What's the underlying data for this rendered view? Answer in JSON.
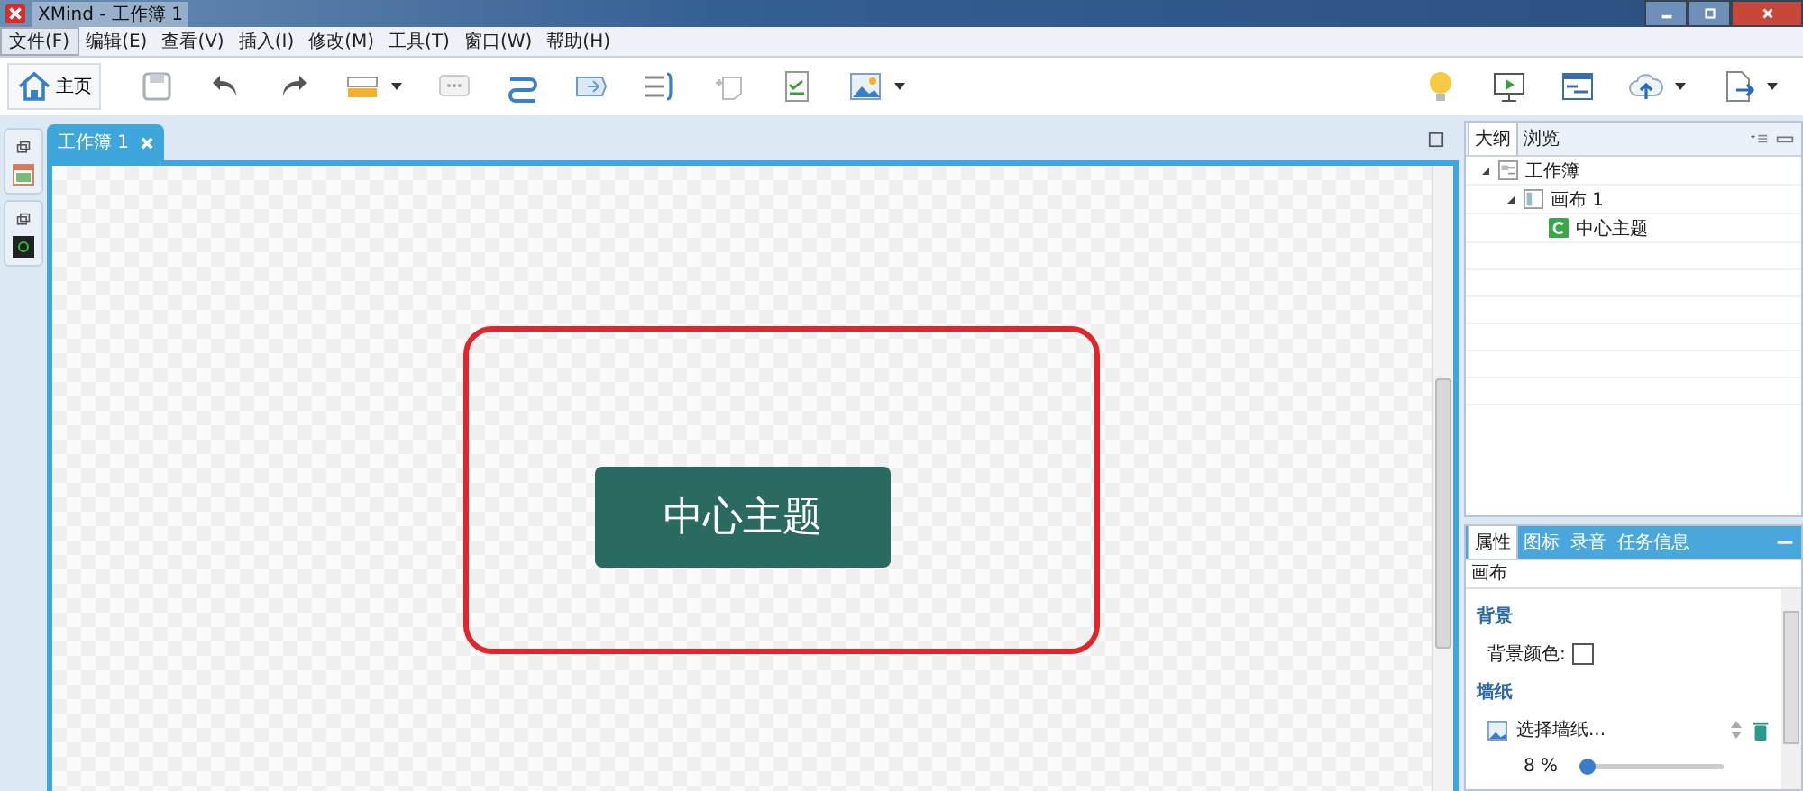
{
  "window": {
    "title": "XMind - 工作簿 1"
  },
  "menu": [
    {
      "label": "文件(F)",
      "selected": true
    },
    {
      "label": "编辑(E)",
      "selected": false
    },
    {
      "label": "查看(V)",
      "selected": false
    },
    {
      "label": "插入(I)",
      "selected": false
    },
    {
      "label": "修改(M)",
      "selected": false
    },
    {
      "label": "工具(T)",
      "selected": false
    },
    {
      "label": "窗口(W)",
      "selected": false
    },
    {
      "label": "帮助(H)",
      "selected": false
    }
  ],
  "toolbar": {
    "home_label": "主页"
  },
  "editor": {
    "tab": "工作簿 1",
    "central_topic": "中心主题"
  },
  "outline": {
    "tabs": [
      {
        "label": "大纲",
        "selected": true
      },
      {
        "label": "浏览",
        "selected": false
      }
    ],
    "tree": [
      {
        "label": "工作簿",
        "kind": "workbook",
        "expanded": true,
        "children": [
          {
            "label": "画布 1",
            "kind": "sheet",
            "expanded": true,
            "children": [
              {
                "label": "中心主题",
                "kind": "topic"
              }
            ]
          }
        ]
      }
    ]
  },
  "properties": {
    "tabs": [
      {
        "label": "属性",
        "selected": true
      },
      {
        "label": "图标",
        "selected": false
      },
      {
        "label": "录音",
        "selected": false
      },
      {
        "label": "任务信息",
        "selected": false
      }
    ],
    "header": "画布",
    "background_heading": "背景",
    "background_color_label": "背景颜色:",
    "wallpaper_heading": "墙纸",
    "wallpaper_choice": "选择墙纸...",
    "opacity": {
      "reading": "8 %",
      "level": 0.05
    }
  }
}
